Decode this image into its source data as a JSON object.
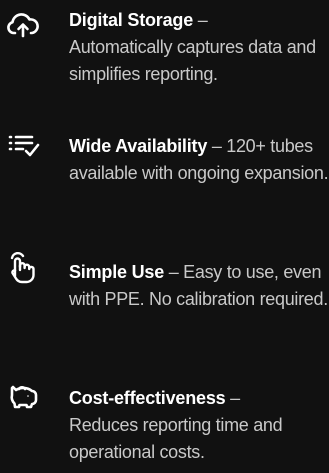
{
  "features": [
    {
      "icon": "cloud-upload-icon",
      "title": "Digital Storage",
      "separator": " –",
      "description": "Automatically captures data and simplifies reporting."
    },
    {
      "icon": "list-check-icon",
      "title": "Wide Availability",
      "separator": " – ",
      "description": "120+ tubes available with ongoing expansion."
    },
    {
      "icon": "tap-pointer-icon",
      "title": "Simple Use",
      "separator": " – ",
      "description": "Easy to use, even with PPE. No calibration required."
    },
    {
      "icon": "piggy-bank-icon",
      "title": "Cost-effectiveness",
      "separator": " –",
      "description": "Reduces reporting time and operational costs."
    }
  ],
  "colors": {
    "background": "#111111",
    "title": "#ffffff",
    "description": "#c9c9c9",
    "icon": "#ffffff"
  }
}
